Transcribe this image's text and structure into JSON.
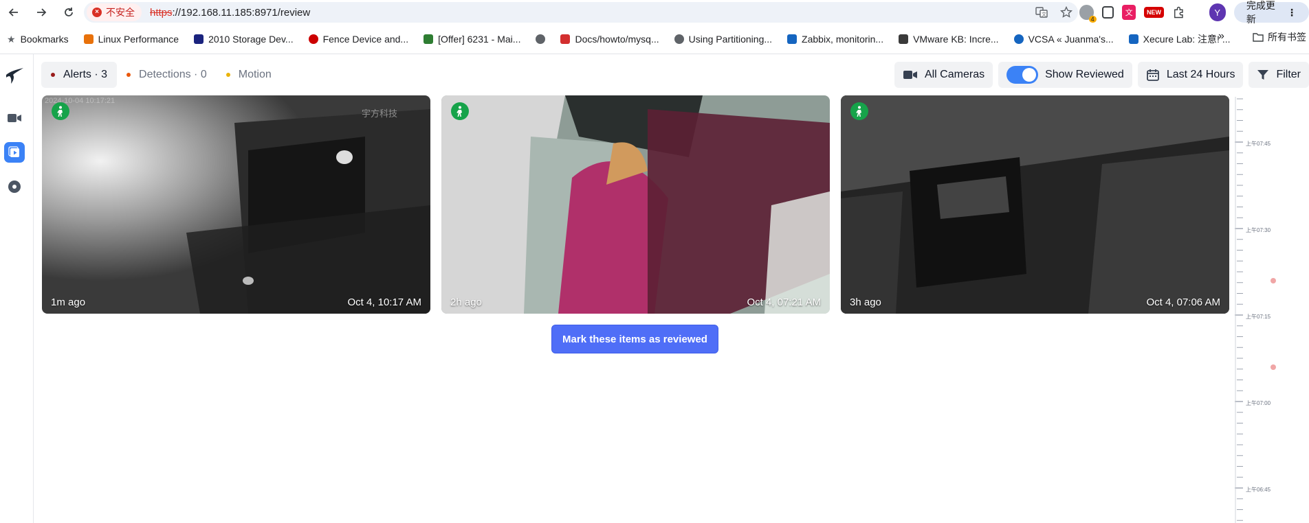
{
  "browser": {
    "insecure_label": "不安全",
    "url_scheme": "https",
    "url_rest": "://192.168.11.185:8971/review",
    "ext_badge_count": "4",
    "ext_new_label": "NEW",
    "profile_initial": "Y",
    "update_label": "完成更新"
  },
  "bookmarks": {
    "items": [
      {
        "label": "Bookmarks",
        "icon": "star-icon",
        "color": "#5f6368"
      },
      {
        "label": "Linux Performance",
        "icon": "flame-icon",
        "color": "#e8710a"
      },
      {
        "label": "2010 Storage Dev...",
        "icon": "storage-icon",
        "color": "#1a237e"
      },
      {
        "label": "Fence Device and...",
        "icon": "redhat-icon",
        "color": "#cc0000"
      },
      {
        "label": "[Offer] 6231 - Mai...",
        "icon": "shield-icon",
        "color": "#2e7d32"
      },
      {
        "label": "",
        "icon": "globe-icon",
        "color": "#5f6368"
      },
      {
        "label": "Docs/howto/mysq...",
        "icon": "z-icon",
        "color": "#d32f2f"
      },
      {
        "label": "Using Partitioning...",
        "icon": "globe-icon",
        "color": "#5f6368"
      },
      {
        "label": "Zabbix, monitorin...",
        "icon": "s-icon",
        "color": "#1565c0"
      },
      {
        "label": "VMware KB: Incre...",
        "icon": "vm-icon",
        "color": "#3a3a3a"
      },
      {
        "label": "VCSA « Juanma's...",
        "icon": "wordpress-icon",
        "color": "#1565c0"
      },
      {
        "label": "Xecure Lab: 注意! ...",
        "icon": "shield-icon",
        "color": "#1565c0"
      }
    ],
    "folder_label": "所有书签"
  },
  "app": {
    "filters": {
      "alerts": {
        "label": "Alerts · 3",
        "color": "#991b1b"
      },
      "detections": {
        "label": "Detections · 0",
        "color": "#ea580c"
      },
      "motion": {
        "label": "Motion",
        "color": "#eab308"
      }
    },
    "controls": {
      "cameras_label": "All Cameras",
      "show_reviewed_label": "Show Reviewed",
      "show_reviewed_on": true,
      "range_label": "Last 24 Hours",
      "filter_label": "Filter"
    },
    "cards": [
      {
        "ago": "1m ago",
        "time": "Oct 4, 10:17 AM",
        "watermark": "2024-10-04 10:17:21",
        "brand": "宇方科技"
      },
      {
        "ago": "2h ago",
        "time": "Oct 4, 07:21 AM"
      },
      {
        "ago": "3h ago",
        "time": "Oct 4, 07:06 AM"
      }
    ],
    "mark_reviewed_label": "Mark these items as reviewed",
    "timeline": {
      "labels": [
        "上午07:45",
        "上午07:30",
        "上午07:15",
        "上午07:00",
        "上午06:45"
      ]
    }
  }
}
